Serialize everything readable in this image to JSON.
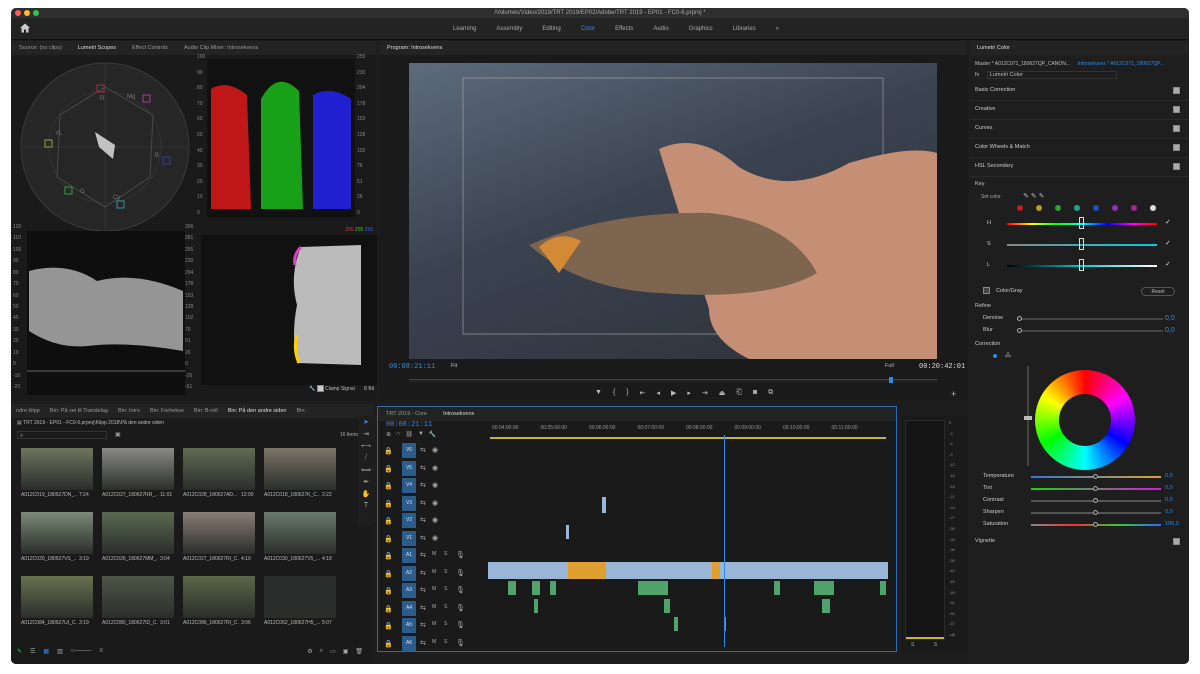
{
  "window": {
    "title": "/Volumes/Video/2019/TRT 2019/EP02/Adobe/TRT 2019 - EP01 - FC0-6.prproj *"
  },
  "workspaces": [
    "Learning",
    "Assembly",
    "Editing",
    "Color",
    "Effects",
    "Audio",
    "Graphics",
    "Libraries"
  ],
  "workspace_active": "Color",
  "workspace_more": "»",
  "source_panel": {
    "tabs": [
      "Source: (no clips)",
      "Lumetri Scopes",
      "Effect Controls",
      "Audio Clip Mixer: Introsekvens"
    ],
    "active": "Lumetri Scopes"
  },
  "vectorscope": {
    "labels": [
      "R",
      "Mg",
      "B",
      "Cy",
      "G",
      "YL"
    ]
  },
  "parade": {
    "scale_left": [
      "100",
      "90",
      "80",
      "70",
      "60",
      "50",
      "40",
      "30",
      "20",
      "10",
      "0"
    ],
    "scale_right": [
      "255",
      "230",
      "204",
      "178",
      "153",
      "128",
      "102",
      "76",
      "51",
      "26",
      "0"
    ]
  },
  "waveform": {
    "scale_left": [
      "120",
      "110",
      "100",
      "90",
      "80",
      "70",
      "60",
      "50",
      "40",
      "30",
      "20",
      "10",
      "0",
      "-10",
      "-20"
    ],
    "scale_right": [
      "306",
      "281",
      "255",
      "230",
      "204",
      "178",
      "153",
      "128",
      "102",
      "76",
      "51",
      "26",
      "0",
      "-26",
      "-51"
    ],
    "rgb_values": [
      "255",
      "255",
      "255"
    ]
  },
  "scopes_footer": {
    "clamp": "Clamp Signal",
    "bit": "8 Bit"
  },
  "program": {
    "title": "Program: Introsekvens",
    "timecode": "00:08:21:11",
    "fit": "Fit",
    "quality": "Full",
    "duration": "00:20:42:01"
  },
  "project": {
    "tabs": [
      "ndre klipp",
      "Bin: På vei til Trøndelag",
      "Bin: Intro",
      "Bin: Forhekse",
      "Bin: B-roll",
      "Bin: På den andre siden",
      "Bin:"
    ],
    "active": "Bin: På den andre siden",
    "path": "TRT 2019 - EP01 - FC0-6.prproj\\Klipp 2018\\På den andre siden",
    "items_count": "16 Items",
    "thumbs": [
      {
        "name": "A012C019_180627DN_...",
        "dur": "7:24",
        "color": "#6d7560"
      },
      {
        "name": "A012C027_180627RR_...",
        "dur": "11:01",
        "color": "#8a8a86"
      },
      {
        "name": "A012C028_180627AD...",
        "dur": "12:00",
        "color": "#5f6b55"
      },
      {
        "name": "A012C018_180627K_C...",
        "dur": "2:22",
        "color": "#7c7466"
      },
      {
        "name": "A012C020_180627VS_...",
        "dur": "3:19",
        "color": "#7b8a78"
      },
      {
        "name": "A012C026_180627MM_...",
        "dur": "3:04",
        "color": "#5a6a52"
      },
      {
        "name": "A012C027_180627RI_C...",
        "dur": "4:10",
        "color": "#8a7d76"
      },
      {
        "name": "A012C030_180627V5_...",
        "dur": "4:18",
        "color": "#6a7a6c"
      },
      {
        "name": "A012C084_180627UI_C...",
        "dur": "3:19",
        "color": "#6a7050"
      },
      {
        "name": "A012C080_180627ID_C...",
        "dur": "3:01",
        "color": "#4d5546"
      },
      {
        "name": "A012C086_180627RI_C...",
        "dur": "3:06",
        "color": "#5a6748"
      },
      {
        "name": "A012C062_180627H5_...",
        "dur": "5:07",
        "color": "#2a2c2c"
      }
    ]
  },
  "timeline": {
    "tabs": [
      "TRT 2019 - Core",
      "Introsekvens"
    ],
    "active": "Introsekvens",
    "timecode": "00:08:21:11",
    "ruler": [
      "00:04:00:00",
      "00:05:00:00",
      "00:06:00:00",
      "00:07:00:00",
      "00:08:00:00",
      "00:09:00:00",
      "00:10:00:00",
      "00:11:00:00"
    ],
    "tracks": [
      "V6",
      "V5",
      "V4",
      "V3",
      "V2",
      "V1",
      "A1",
      "A2",
      "A3",
      "A4",
      "A5",
      "A6"
    ],
    "meter_scale": [
      "0",
      "-3",
      "-6",
      "-9",
      "-12",
      "-15",
      "-18",
      "-21",
      "-24",
      "-27",
      "-30",
      "-33",
      "-36",
      "-39",
      "-42",
      "-45",
      "-48",
      "-51",
      "-54",
      "-57",
      "-dB"
    ],
    "meter_bottom": [
      "S",
      "S"
    ]
  },
  "lumetri": {
    "title": "Lumetri Color",
    "master": "Master * A012C071_180627QP_CANON...",
    "seq": "Introsekvens * A012C071_180627QP...",
    "fx": "fx",
    "effect": "Lumetri Color",
    "sections": [
      "Basic Correction",
      "Creative",
      "Curves",
      "Color Wheels & Match",
      "HSL Secondary"
    ],
    "key": "Key",
    "set_color": "Set color",
    "hsl": [
      "H",
      "S",
      "L"
    ],
    "color_gray": "Color/Gray",
    "reset": "Reset",
    "refine": "Refine",
    "denoise": "Denoise",
    "denoise_val": "0,0",
    "blur": "Blur",
    "blur_val": "0,0",
    "correction": "Correction",
    "params": [
      {
        "label": "Temperature",
        "val": "0,0"
      },
      {
        "label": "Tint",
        "val": "0,0"
      },
      {
        "label": "Contrast",
        "val": "0,0"
      },
      {
        "label": "Sharpen",
        "val": "0,0"
      },
      {
        "label": "Saturation",
        "val": "100,0"
      }
    ],
    "vignette": "Vignette",
    "swatches": [
      "#c02020",
      "#b0a020",
      "#30a030",
      "#20a090",
      "#2050c0",
      "#9030b0",
      "#b02090",
      "#dddddd"
    ]
  }
}
